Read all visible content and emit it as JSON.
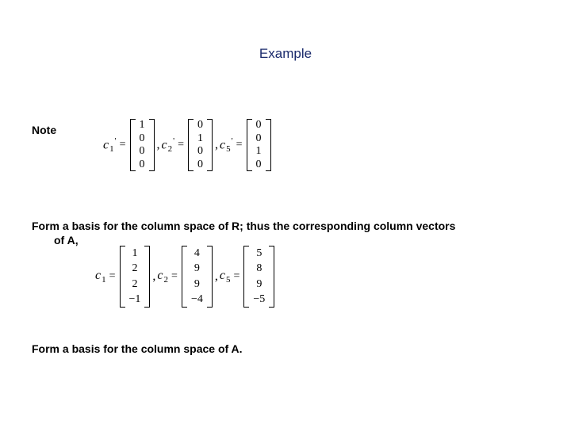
{
  "title": "Example",
  "note": "Note",
  "eq1": {
    "c1": {
      "name": "c",
      "sub": "1",
      "sup": "'",
      "vec": [
        "1",
        "0",
        "0",
        "0"
      ]
    },
    "c2": {
      "name": "c",
      "sub": "2",
      "sup": "'",
      "vec": [
        "0",
        "1",
        "0",
        "0"
      ]
    },
    "c5": {
      "name": "c",
      "sub": "5",
      "sup": "'",
      "vec": [
        "0",
        "0",
        "1",
        "0"
      ]
    }
  },
  "para1_a": "Form a basis for the column space of R; thus the corresponding column vectors",
  "para1_b": "of A,",
  "eq2": {
    "c1": {
      "name": "c",
      "sub": "1",
      "vec": [
        "1",
        "2",
        "2",
        "−1"
      ]
    },
    "c2": {
      "name": "c",
      "sub": "2",
      "vec": [
        "4",
        "9",
        "9",
        "−4"
      ]
    },
    "c5": {
      "name": "c",
      "sub": "5",
      "vec": [
        "5",
        "8",
        "9",
        "−5"
      ]
    }
  },
  "para2": "Form a basis for the column space of A.",
  "sym": {
    "eq": "=",
    "comma": ","
  }
}
